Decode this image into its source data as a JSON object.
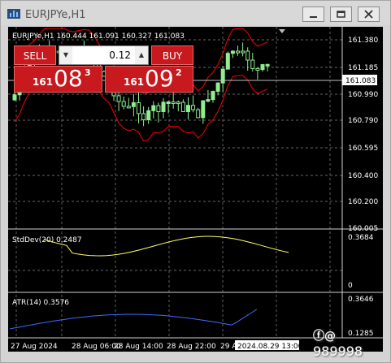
{
  "window": {
    "title": "EURJPYe,H1"
  },
  "chart": {
    "info_line": "EURJPYe,H1  160.444 161.091 160.327 161.083",
    "price_labels": [
      "161.380",
      "161.185",
      "160.990",
      "160.790",
      "160.595",
      "160.400",
      "160.200",
      "160.005"
    ],
    "current_price": "161.083",
    "time_labels": [
      "27 Aug 2024",
      "28 Aug 06:00",
      "28 Aug 14:00",
      "28 Aug 22:00",
      "29 Aug"
    ],
    "crosshair_time": "2024.08.29 13:00",
    "colors": {
      "background": "#000000",
      "bull": "#90ee90",
      "bear": "#000000",
      "bands": "#ff0000",
      "stddev": "#ffff66",
      "atr": "#3c6cff",
      "grid": "#d0d0d0"
    }
  },
  "trade_panel": {
    "sell_label": "SELL",
    "buy_label": "BUY",
    "lot_value": "0.12",
    "bid": {
      "prefix": "161",
      "big": "08",
      "sup": "3"
    },
    "ask": {
      "prefix": "161",
      "big": "09",
      "sup": "2"
    }
  },
  "stddev": {
    "label": "StdDev(20) 0.2487",
    "top": "0.3684",
    "bottom": "0"
  },
  "atr": {
    "label": "ATR(14) 0.3576",
    "top": "0.3646",
    "bottom": "0.1285"
  },
  "watermark": {
    "text": "989998"
  }
}
